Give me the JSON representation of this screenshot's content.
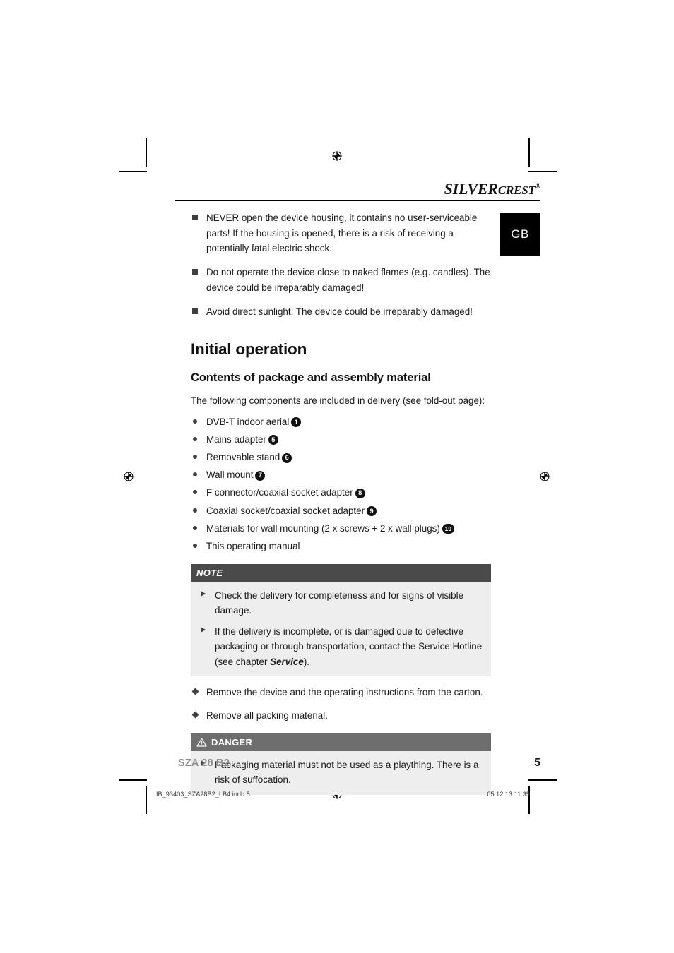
{
  "header": {
    "brand_main": "SILVER",
    "brand_second": "CREST",
    "brand_reg": "®",
    "language_tab": "GB"
  },
  "safety_warnings": [
    "NEVER open the device housing, it contains no user-serviceable parts! If the housing is opened, there is a risk of receiving a potentially fatal electric shock.",
    "Do not operate the device close to naked flames (e.g. candles). The device could be irreparably damaged!",
    "Avoid direct sunlight. The device could be irreparably damaged!"
  ],
  "main": {
    "section_title": "Initial operation",
    "sub_title": "Contents of package and assembly material",
    "intro": "The following components are included in delivery (see fold-out page):",
    "package_contents": [
      {
        "label": "DVB-T indoor aerial",
        "number": "1"
      },
      {
        "label": "Mains adapter",
        "number": "5"
      },
      {
        "label": "Removable stand",
        "number": "6"
      },
      {
        "label": "Wall mount",
        "number": "7"
      },
      {
        "label": "F connector/coaxial socket adapter",
        "number": "8"
      },
      {
        "label": "Coaxial socket/coaxial socket adapter",
        "number": "9"
      },
      {
        "label": "Materials for wall mounting (2 x screws + 2 x wall plugs)",
        "number": "10"
      },
      {
        "label": "This operating manual",
        "number": ""
      }
    ]
  },
  "note_box": {
    "title": "NOTE",
    "items": [
      {
        "text_before": "Check the delivery for completeness and for signs of visible damage.",
        "emphasis": "",
        "text_after": ""
      },
      {
        "text_before": "If the delivery is incomplete, or is damaged due to defective packaging or through transportation, contact the Service Hotline (see chapter ",
        "emphasis": "Service",
        "text_after": ")."
      }
    ]
  },
  "unpacking_steps": [
    "Remove the device and the operating instructions from the carton.",
    "Remove all packing material."
  ],
  "danger_box": {
    "title": "DANGER",
    "icon": "warning-triangle-icon",
    "items": [
      "Packaging material must not be used as a plaything. There is a risk of suffocation."
    ]
  },
  "footer": {
    "model": "SZA 28 B2",
    "page_number": "5",
    "imprint_file": "IB_93403_SZA28B2_LB4.indb   5",
    "imprint_timestamp": "05.12.13   11:35"
  },
  "colors": {
    "note_header": "#4a4a4a",
    "danger_header": "#6e6e6e",
    "callout_body": "#eeeeee",
    "lang_tab": "#000000",
    "footer_model": "#8c8c8c"
  }
}
